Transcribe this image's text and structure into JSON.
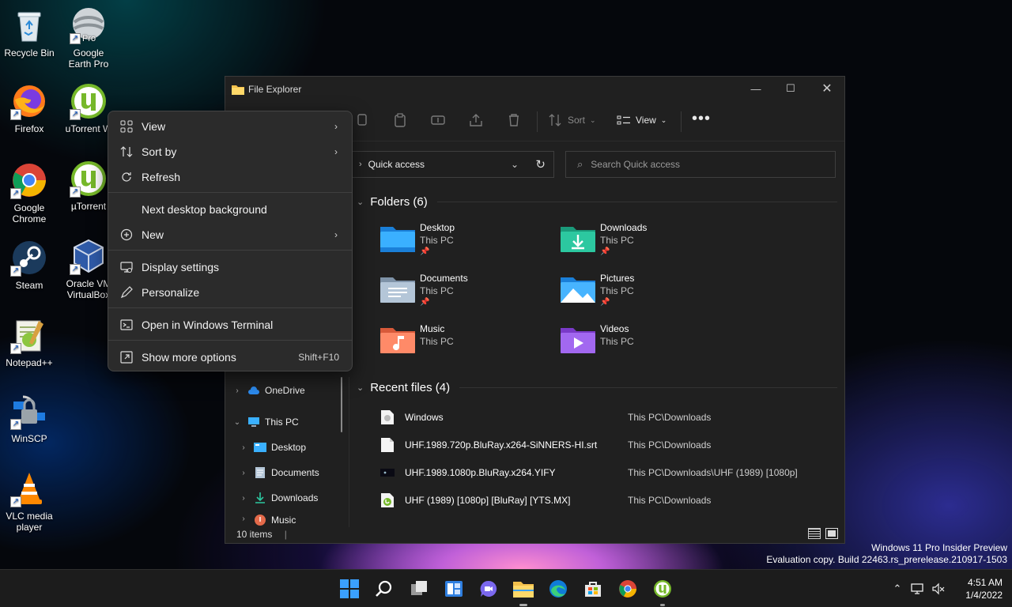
{
  "desktop": {
    "icons": [
      {
        "label": "Recycle Bin",
        "icon": "recycle-bin-icon"
      },
      {
        "label": "Google Earth Pro",
        "icon": "google-earth-icon",
        "overlay": "Pro"
      },
      {
        "label": "Firefox",
        "icon": "firefox-icon"
      },
      {
        "label": "uTorrent W",
        "icon": "utorrent-icon"
      },
      {
        "label": "Google Chrome",
        "icon": "chrome-icon"
      },
      {
        "label": "µTorrent",
        "icon": "utorrent-icon"
      },
      {
        "label": "Steam",
        "icon": "steam-icon"
      },
      {
        "label": "Oracle VM VirtualBox",
        "icon": "virtualbox-icon"
      },
      {
        "label": "Notepad++",
        "icon": "notepadpp-icon"
      },
      {
        "label": "WinSCP",
        "icon": "winscp-icon"
      },
      {
        "label": "VLC media player",
        "icon": "vlc-icon"
      }
    ],
    "watermark": {
      "line1": "Windows 11 Pro Insider Preview",
      "line2": "Evaluation copy. Build 22463.rs_prerelease.210917-1503"
    }
  },
  "explorer": {
    "title": "File Explorer",
    "toolbar": {
      "sort_label": "Sort",
      "view_label": "View"
    },
    "address": "Quick access",
    "search_placeholder": "Search Quick access",
    "folders_header": "Folders (6)",
    "folders": [
      {
        "name": "Desktop",
        "location": "This PC",
        "pinned": true
      },
      {
        "name": "Downloads",
        "location": "This PC",
        "pinned": true
      },
      {
        "name": "Documents",
        "location": "This PC",
        "pinned": true
      },
      {
        "name": "Pictures",
        "location": "This PC",
        "pinned": true
      },
      {
        "name": "Music",
        "location": "This PC",
        "pinned": false
      },
      {
        "name": "Videos",
        "location": "This PC",
        "pinned": false
      }
    ],
    "recent_header": "Recent files (4)",
    "recent": [
      {
        "name": "Windows",
        "location": "This PC\\Downloads"
      },
      {
        "name": "UHF.1989.720p.BluRay.x264-SiNNERS-HI.srt",
        "location": "This PC\\Downloads"
      },
      {
        "name": "UHF.1989.1080p.BluRay.x264.YIFY",
        "location": "This PC\\Downloads\\UHF (1989) [1080p]"
      },
      {
        "name": "UHF (1989) [1080p] [BluRay] [YTS.MX]",
        "location": "This PC\\Downloads"
      }
    ],
    "nav": [
      {
        "label": "OneDrive",
        "indent": 0
      },
      {
        "label": "This PC",
        "indent": 0
      },
      {
        "label": "Desktop",
        "indent": 1
      },
      {
        "label": "Documents",
        "indent": 1
      },
      {
        "label": "Downloads",
        "indent": 1
      },
      {
        "label": "Music",
        "indent": 1
      }
    ],
    "status": "10 items"
  },
  "context_menu": {
    "items": [
      {
        "label": "View",
        "icon": "grid-icon",
        "submenu": true
      },
      {
        "label": "Sort by",
        "icon": "sort-icon",
        "submenu": true
      },
      {
        "label": "Refresh",
        "icon": "refresh-icon"
      },
      {
        "label": "Next desktop background",
        "icon": ""
      },
      {
        "label": "New",
        "icon": "plus-circle-icon",
        "submenu": true
      },
      {
        "label": "Display settings",
        "icon": "display-icon"
      },
      {
        "label": "Personalize",
        "icon": "pen-icon"
      },
      {
        "label": "Open in Windows Terminal",
        "icon": "terminal-icon"
      },
      {
        "label": "Show more options",
        "icon": "more-options-icon",
        "shortcut": "Shift+F10"
      }
    ]
  },
  "taskbar": {
    "clock_time": "4:51 AM",
    "clock_date": "1/4/2022"
  }
}
